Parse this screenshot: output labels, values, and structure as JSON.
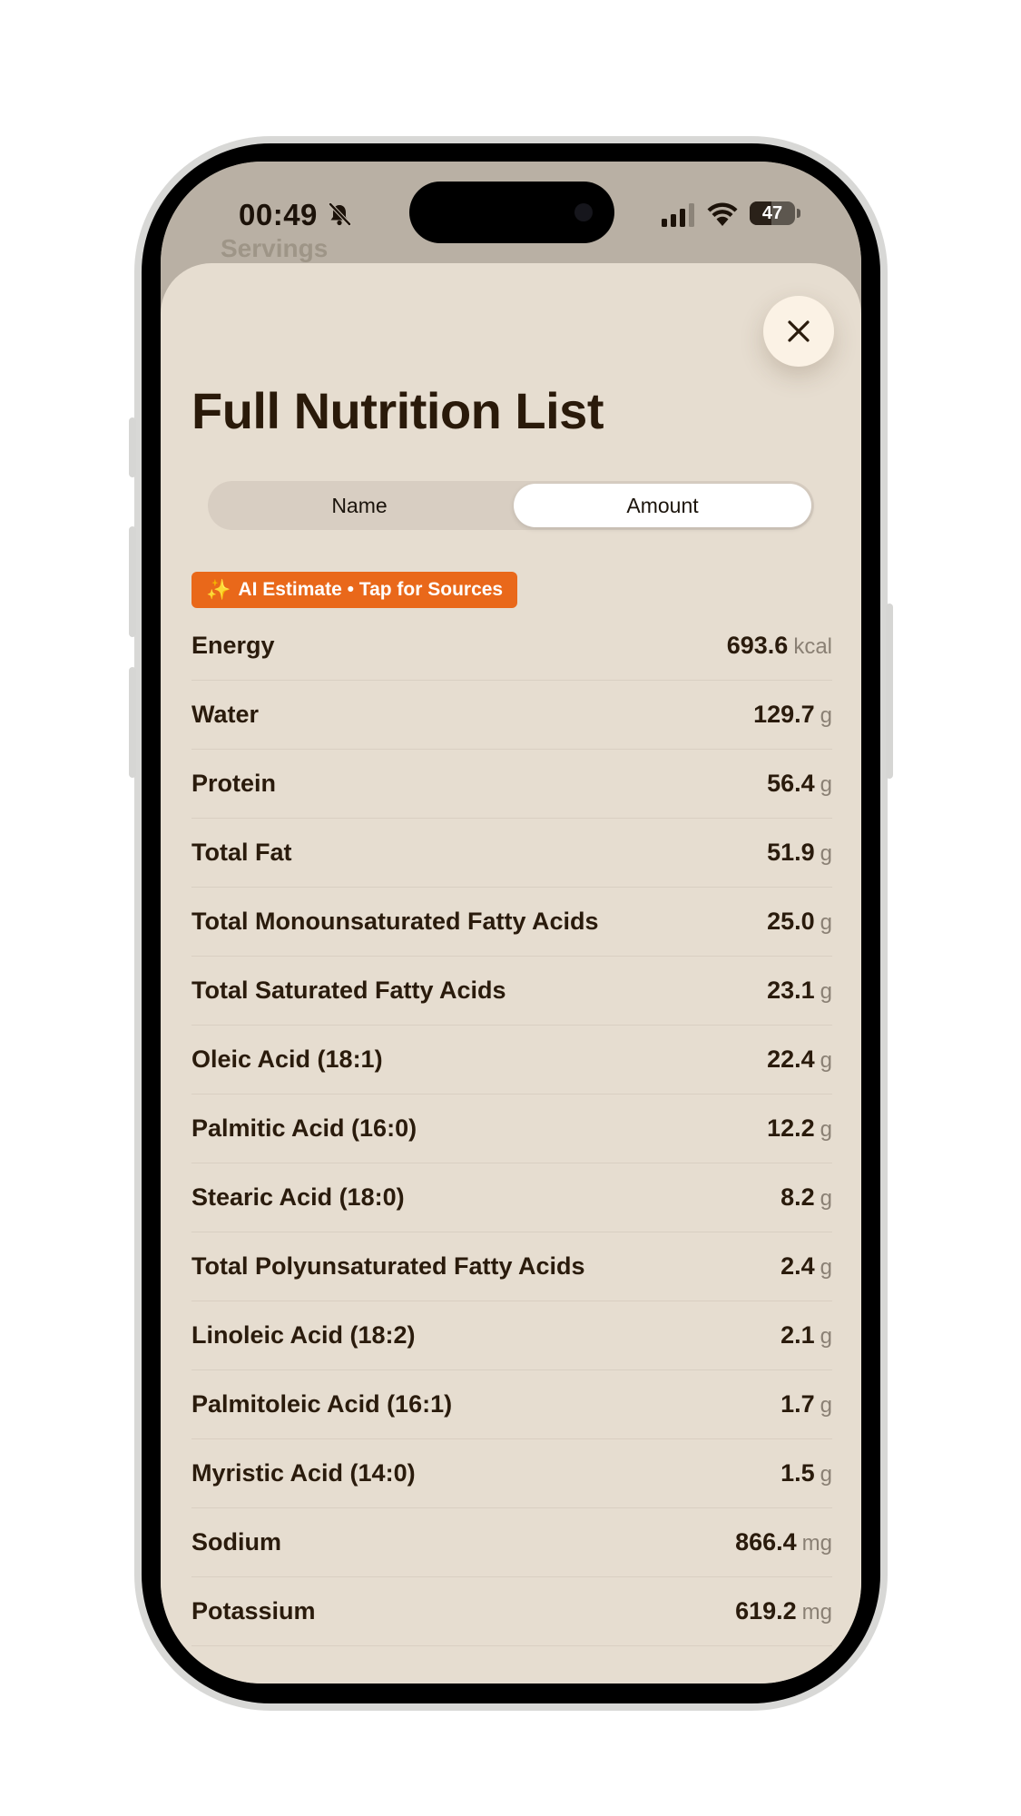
{
  "status_bar": {
    "time": "00:49",
    "battery_level": "47"
  },
  "background": {
    "servings_label": "Servings"
  },
  "sheet": {
    "title": "Full Nutrition List",
    "sort_tabs": [
      {
        "label": "Name",
        "selected": false
      },
      {
        "label": "Amount",
        "selected": true
      }
    ],
    "ai_badge": {
      "icon": "sparkles-icon",
      "label": "AI Estimate • Tap for Sources"
    },
    "nutrients": [
      {
        "name": "Energy",
        "amount": "693.6",
        "unit": "kcal"
      },
      {
        "name": "Water",
        "amount": "129.7",
        "unit": "g"
      },
      {
        "name": "Protein",
        "amount": "56.4",
        "unit": "g"
      },
      {
        "name": "Total Fat",
        "amount": "51.9",
        "unit": "g"
      },
      {
        "name": "Total Monounsaturated Fatty Acids",
        "amount": "25.0",
        "unit": "g"
      },
      {
        "name": "Total Saturated Fatty Acids",
        "amount": "23.1",
        "unit": "g"
      },
      {
        "name": "Oleic Acid (18:1)",
        "amount": "22.4",
        "unit": "g"
      },
      {
        "name": "Palmitic Acid (16:0)",
        "amount": "12.2",
        "unit": "g"
      },
      {
        "name": "Stearic Acid (18:0)",
        "amount": "8.2",
        "unit": "g"
      },
      {
        "name": "Total Polyunsaturated Fatty Acids",
        "amount": "2.4",
        "unit": "g"
      },
      {
        "name": "Linoleic Acid (18:2)",
        "amount": "2.1",
        "unit": "g"
      },
      {
        "name": "Palmitoleic Acid (16:1)",
        "amount": "1.7",
        "unit": "g"
      },
      {
        "name": "Myristic Acid (14:0)",
        "amount": "1.5",
        "unit": "g"
      },
      {
        "name": "Sodium",
        "amount": "866.4",
        "unit": "mg"
      },
      {
        "name": "Potassium",
        "amount": "619.2",
        "unit": "mg"
      }
    ]
  },
  "colors": {
    "sheet_background": "#e6ddd0",
    "accent_orange": "#e9681a",
    "text_dark": "#2a1b0c",
    "unit_gray": "#8a8074"
  }
}
